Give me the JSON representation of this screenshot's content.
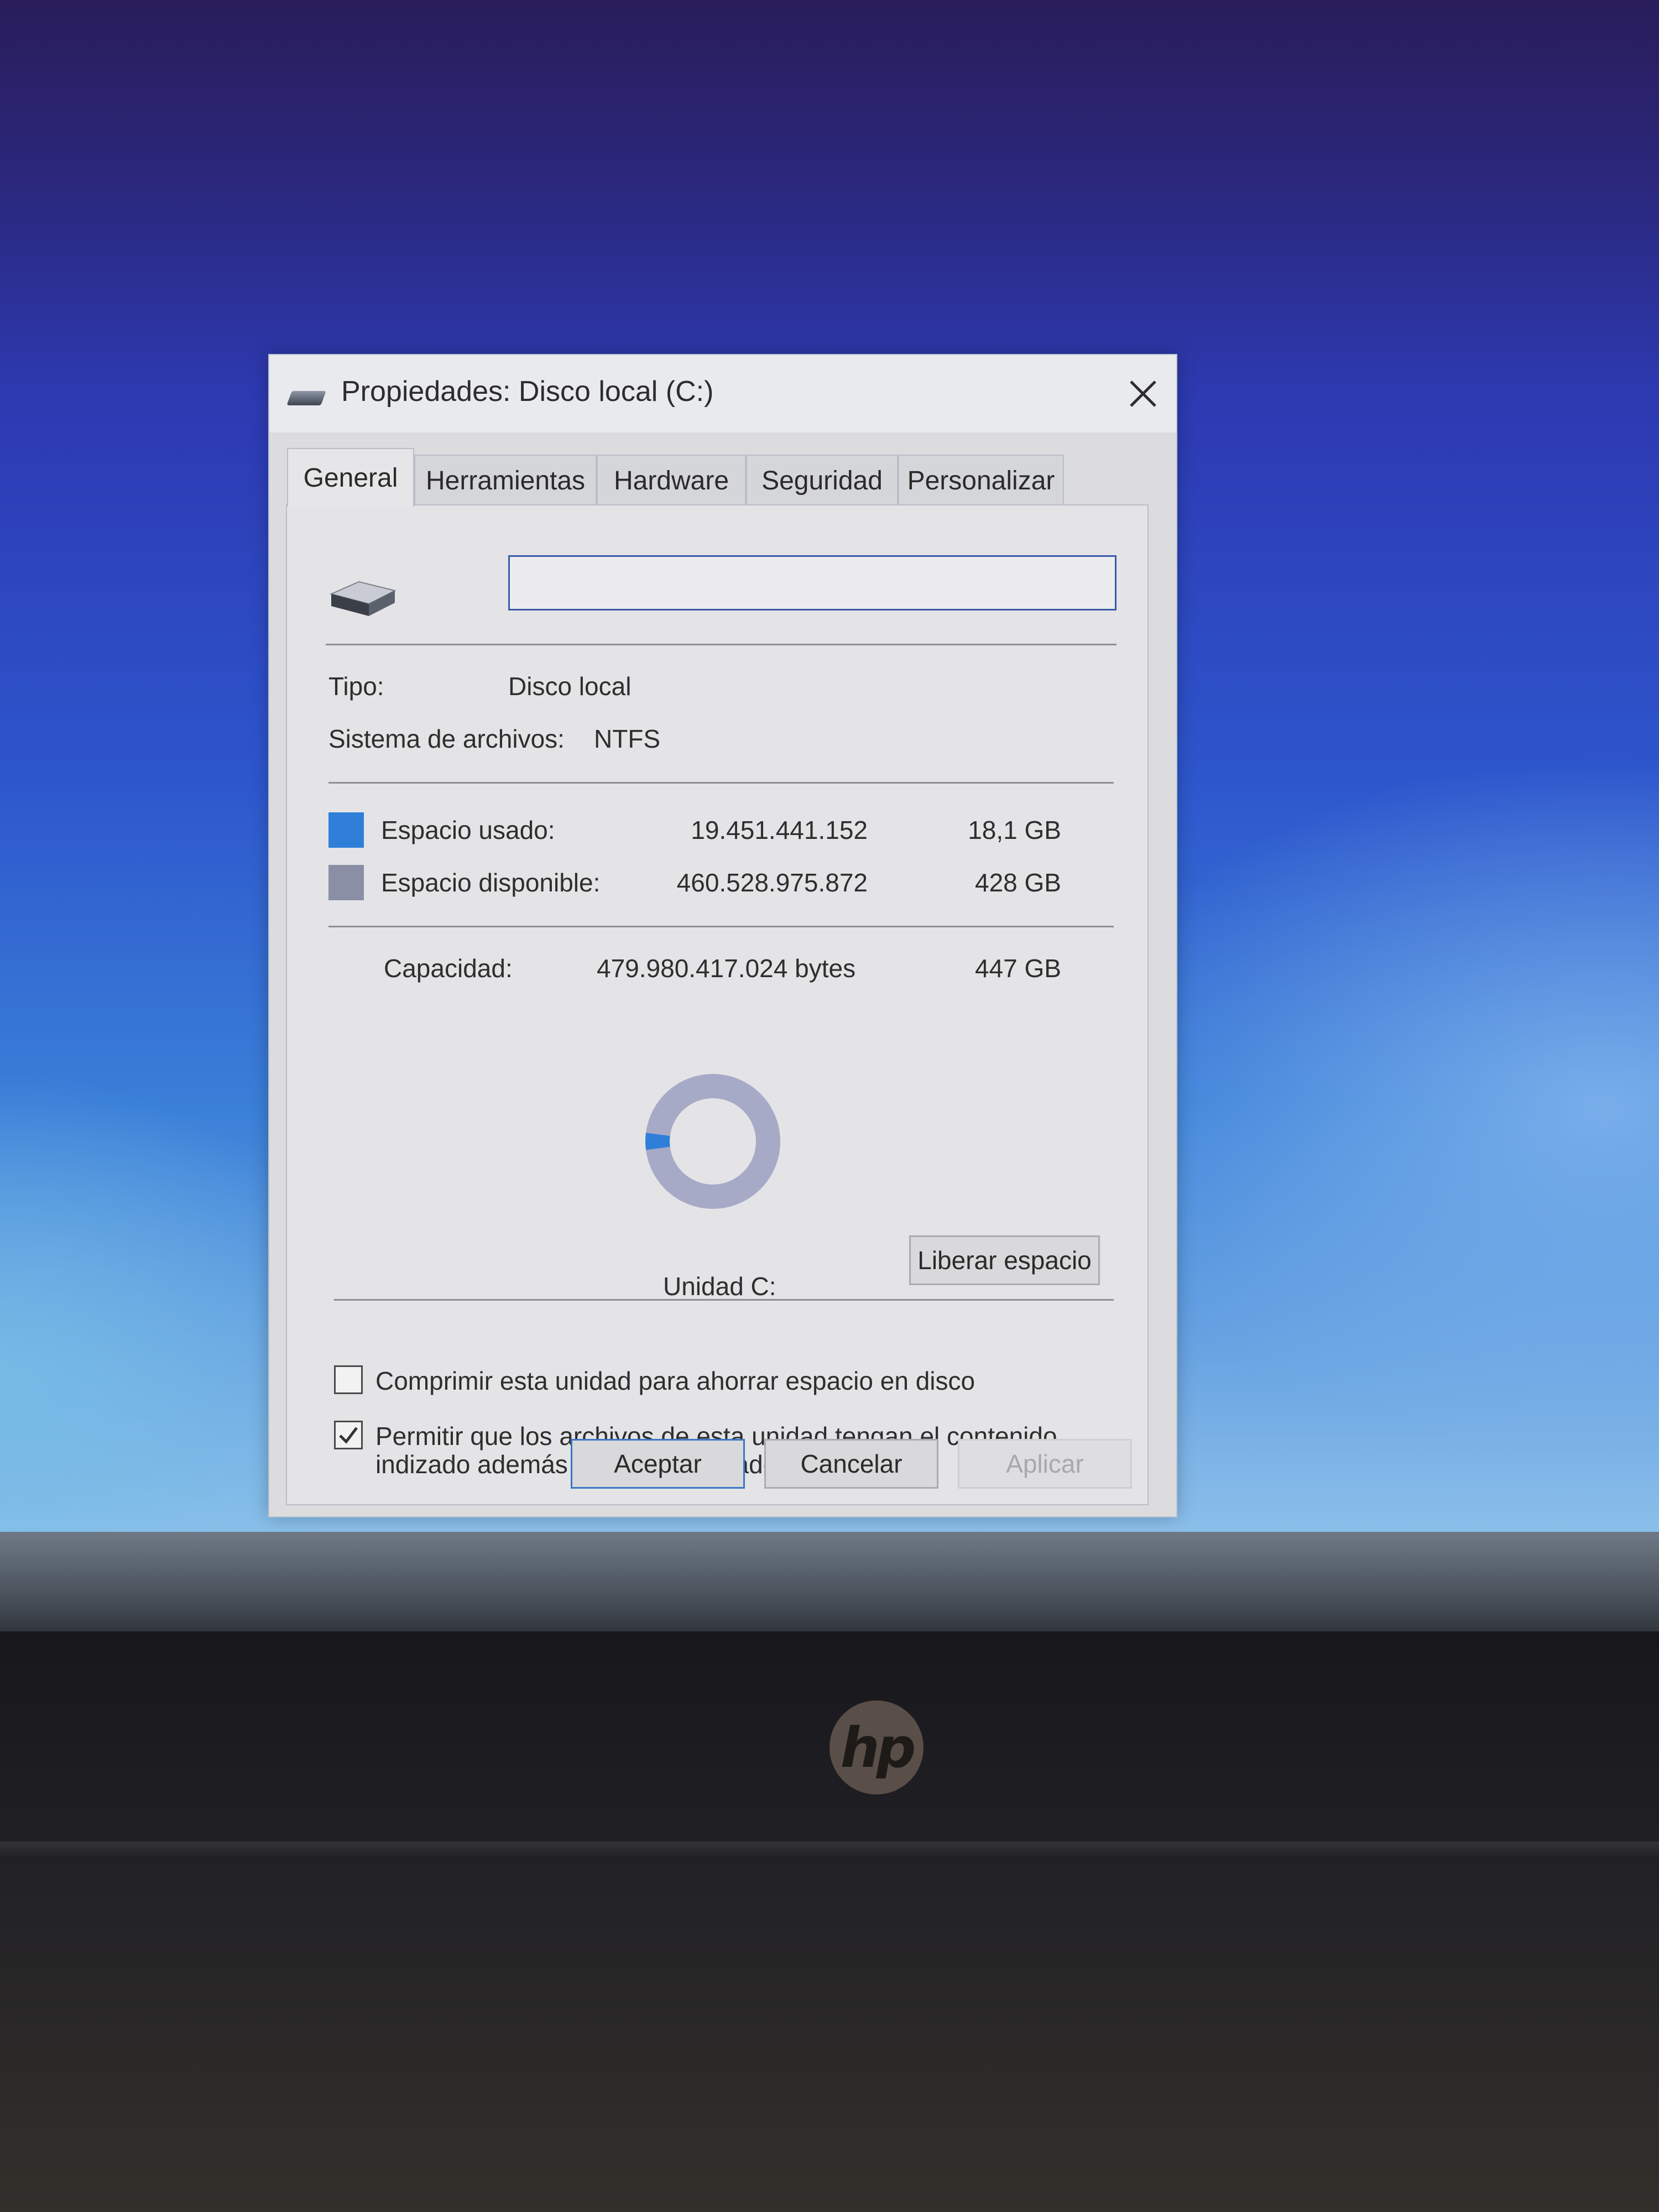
{
  "window": {
    "title": "Propiedades: Disco local (C:)"
  },
  "tabs": [
    {
      "label": "General",
      "active": true
    },
    {
      "label": "Herramientas"
    },
    {
      "label": "Hardware"
    },
    {
      "label": "Seguridad"
    },
    {
      "label": "Personalizar"
    }
  ],
  "general": {
    "name_value": "",
    "type_label": "Tipo:",
    "type_value": "Disco local",
    "fs_label": "Sistema de archivos:",
    "fs_value": "NTFS",
    "used": {
      "label": "Espacio usado:",
      "bytes": "19.451.441.152",
      "size": "18,1 GB",
      "color": "#2f7fd9"
    },
    "free": {
      "label": "Espacio disponible:",
      "bytes": "460.528.975.872",
      "size": "428 GB",
      "color": "#8a8fa6"
    },
    "capacity": {
      "label": "Capacidad:",
      "bytes": "479.980.417.024 bytes",
      "size": "447 GB"
    },
    "drive_label": "Unidad C:",
    "cleanup_button": "Liberar espacio",
    "used_fraction": 0.0405,
    "compress_checkbox": {
      "label": "Comprimir esta unidad para ahorrar espacio en disco",
      "checked": false
    },
    "index_checkbox": {
      "label_line1": "Permitir que los archivos de esta unidad tengan el contenido",
      "label_line2": "indizado además de las propiedades de archivo",
      "checked": true
    }
  },
  "buttons": {
    "ok": "Aceptar",
    "cancel": "Cancelar",
    "apply": "Aplicar"
  },
  "laptop": {
    "logo": "hp"
  }
}
